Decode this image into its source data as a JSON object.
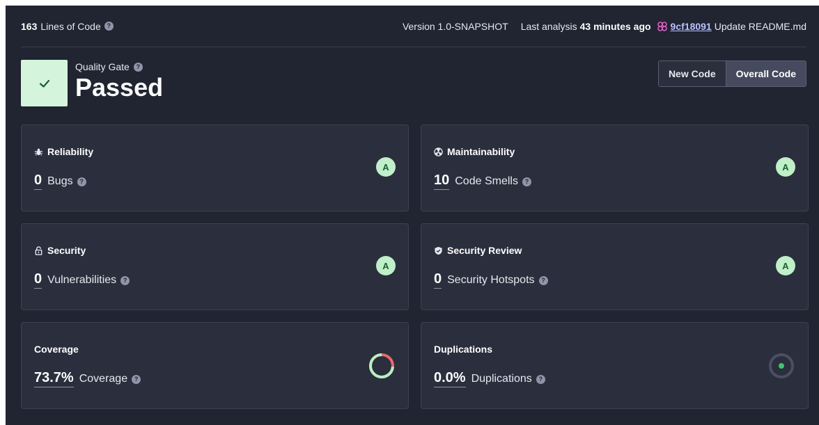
{
  "topbar": {
    "lines_count": "163",
    "lines_label": "Lines of Code",
    "version": "Version 1.0-SNAPSHOT",
    "last_analysis_prefix": "Last analysis",
    "last_analysis_time": "43 minutes ago",
    "commit_hash": "9cf18091",
    "commit_message": "Update README.md"
  },
  "quality_gate": {
    "label": "Quality Gate",
    "status": "Passed"
  },
  "toggle": {
    "new_code": "New Code",
    "overall_code": "Overall Code",
    "active": "overall_code"
  },
  "cards": {
    "reliability": {
      "title": "Reliability",
      "value": "0",
      "label": "Bugs",
      "rating": "A"
    },
    "maintainability": {
      "title": "Maintainability",
      "value": "10",
      "label": "Code Smells",
      "rating": "A"
    },
    "security": {
      "title": "Security",
      "value": "0",
      "label": "Vulnerabilities",
      "rating": "A"
    },
    "security_review": {
      "title": "Security Review",
      "value": "0",
      "label": "Security Hotspots",
      "rating": "A"
    },
    "coverage": {
      "title": "Coverage",
      "value": "73.7%",
      "label": "Coverage",
      "fraction": 0.737
    },
    "duplications": {
      "title": "Duplications",
      "value": "0.0%",
      "label": "Duplications",
      "fraction": 0.0
    }
  },
  "colors": {
    "background": "#212431",
    "card": "#2b2e3c",
    "rating_bg": "#bff0c8",
    "rating_fg": "#1b5e30",
    "passed_box": "#d5f4dc",
    "coverage_covered": "#b7f0c4",
    "coverage_uncovered": "#e86a6a",
    "duplication_dot": "#2ecc71",
    "link": "#b8c2ff"
  }
}
